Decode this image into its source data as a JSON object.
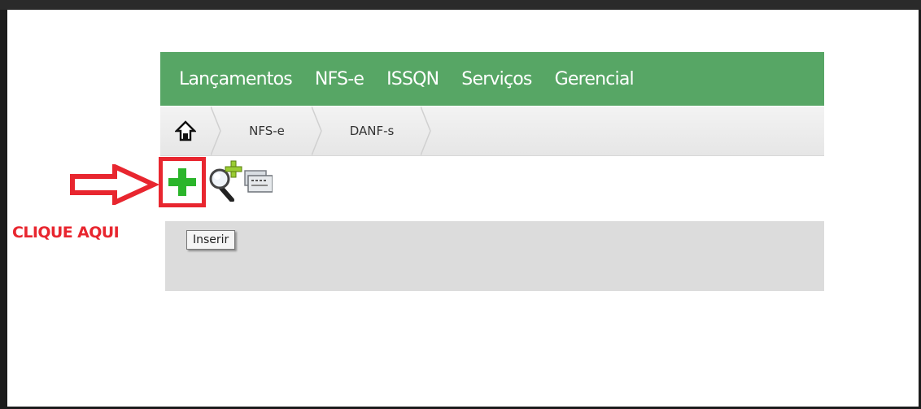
{
  "menu": {
    "items": [
      "Lançamentos",
      "NFS-e",
      "ISSQN",
      "Serviços",
      "Gerencial"
    ]
  },
  "breadcrumb": {
    "home_icon": "home-icon",
    "items": [
      "NFS-e",
      "DANF-s"
    ]
  },
  "toolbar": {
    "insert_icon": "plus-icon",
    "search_add_icon": "magnifier-plus-icon",
    "print_icon": "printer-icon"
  },
  "annotation": {
    "label": "CLIQUE AQUI",
    "arrow_icon": "arrow-right-outline-icon"
  },
  "tooltip": {
    "text": "Inserir"
  },
  "colors": {
    "menu_bg": "#57a665",
    "annotation_red": "#e8262f",
    "plus_green": "#2bb52b",
    "panel_gray": "#dcdcdc"
  }
}
